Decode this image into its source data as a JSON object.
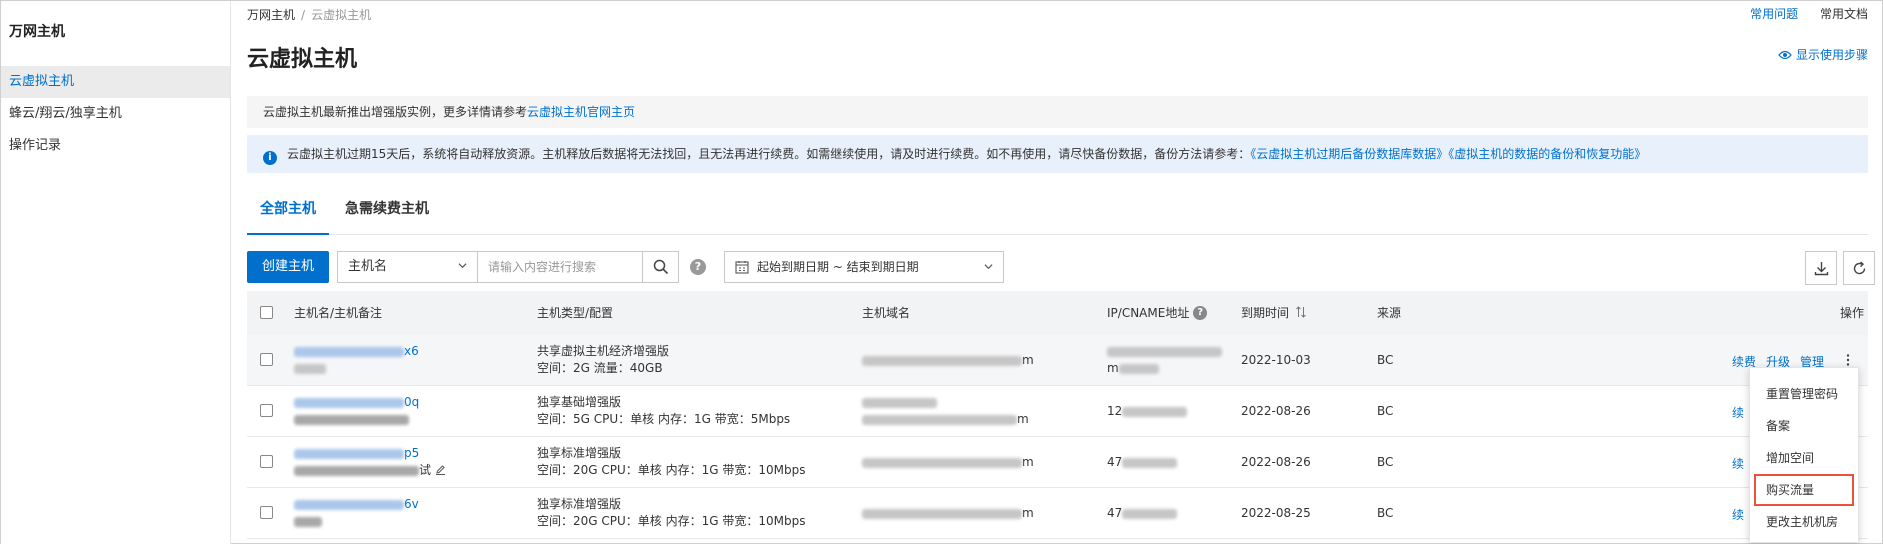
{
  "sidebar": {
    "title": "万网主机",
    "items": [
      {
        "label": "云虚拟主机",
        "active": true
      },
      {
        "label": "蜂云/翔云/独享主机",
        "active": false
      },
      {
        "label": "操作记录",
        "active": false
      }
    ]
  },
  "breadcrumb": {
    "root": "万网主机",
    "current": "云虚拟主机"
  },
  "top_links": {
    "faq": "常用问题",
    "docs": "常用文档"
  },
  "page_title": "云虚拟主机",
  "show_steps": "显示使用步骤",
  "notice": {
    "text": "云虚拟主机最新推出增强版实例，更多详情请参考",
    "link": "云虚拟主机官网主页"
  },
  "info": {
    "text": "云虚拟主机过期15天后，系统将自动释放资源。主机释放后数据将无法找回，且无法再进行续费。如需继续使用，请及时进行续费。如不再使用，请尽快备份数据，备份方法请参考：",
    "link1": "《云虚拟主机过期后备份数据库数据》",
    "link2": "《虚拟主机的数据的备份和恢复功能》"
  },
  "tabs": [
    {
      "label": "全部主机",
      "active": true
    },
    {
      "label": "急需续费主机",
      "active": false
    }
  ],
  "toolbar": {
    "create_label": "创建主机",
    "filter_select": "主机名",
    "search_placeholder": "请输入内容进行搜索",
    "date_range": "起始到期日期 ~ 结束到期日期"
  },
  "table": {
    "headers": {
      "name": "主机名/主机备注",
      "type": "主机类型/配置",
      "domain": "主机域名",
      "ip": "IP/CNAME地址",
      "expire": "到期时间",
      "source": "来源",
      "action": "操作"
    },
    "rows": [
      {
        "name_suffix": "x6",
        "type": "共享虚拟主机经济增强版",
        "config": "空间：2G 流量：40GB",
        "domain_suffix": "m",
        "ip_suffix": "m",
        "expire": "2022-10-03",
        "source": "BC"
      },
      {
        "name_suffix": "0q",
        "type": "独享基础增强版",
        "config": "空间：5G CPU：单核 内存：1G 带宽：5Mbps",
        "domain_suffix": "m",
        "ip_prefix": "12",
        "expire": "2022-08-26",
        "source": "BC"
      },
      {
        "name_suffix": "p5",
        "note_suffix": "试",
        "type": "独享标准增强版",
        "config": "空间：20G CPU：单核 内存：1G 带宽：10Mbps",
        "domain_suffix": "m",
        "ip_prefix": "47",
        "expire": "2022-08-26",
        "source": "BC"
      },
      {
        "name_suffix": "6v",
        "type": "独享标准增强版",
        "config": "空间：20G CPU：单核 内存：1G 带宽：10Mbps",
        "domain_suffix": "m",
        "ip_prefix": "47",
        "expire": "2022-08-25",
        "source": "BC"
      }
    ],
    "actions": {
      "renew": "续费",
      "upgrade": "升级",
      "manage": "管理",
      "renew_partial": "续"
    }
  },
  "dropdown_menu": {
    "items": [
      "重置管理密码",
      "备案",
      "增加空间",
      "购买流量",
      "更改主机机房"
    ],
    "highlighted": "购买流量"
  }
}
